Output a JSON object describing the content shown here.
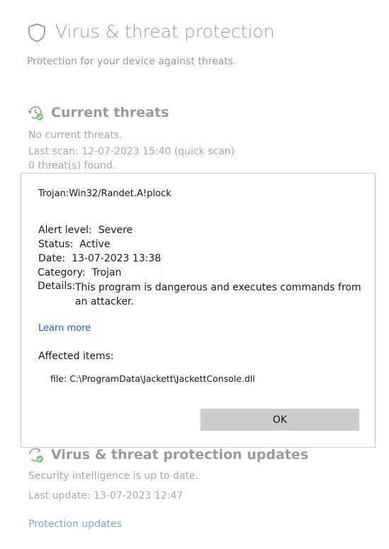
{
  "page": {
    "title": "Virus & threat protection",
    "subtitle": "Protection for your device against threats."
  },
  "current_threats": {
    "heading": "Current threats",
    "lines": [
      "No current threats.",
      "Last scan: 12-07-2023 15:40 (quick scan)",
      "0 threat(s) found."
    ]
  },
  "updates": {
    "heading": "Virus & threat protection updates",
    "status": "Security intelligence is up to date.",
    "last_update": "Last update: 13-07-2023 12:47",
    "link": "Protection updates"
  },
  "dialog": {
    "threat_name": "Trojan:Win32/Randet.A!plock",
    "alert_level_label": "Alert level:",
    "alert_level": "Severe",
    "status_label": "Status:",
    "status": "Active",
    "date_label": "Date:",
    "date": "13-07-2023 13:38",
    "category_label": "Category:",
    "category": "Trojan",
    "details_label": "Details:",
    "details": "This program is dangerous and executes commands from an attacker.",
    "learn_more": "Learn more",
    "affected_label": "Affected items:",
    "affected_item": "file: C:\\ProgramData\\Jackett\\JackettConsole.dll",
    "ok_label": "OK"
  },
  "colors": {
    "link": "#1565b8",
    "faded_text": "#9a9a9a",
    "ok_button": "#cccccc"
  }
}
